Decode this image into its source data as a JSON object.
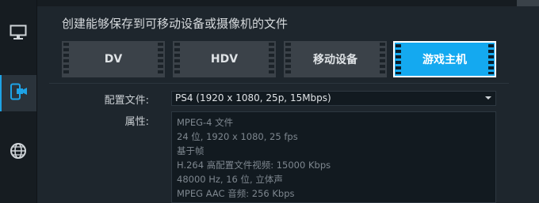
{
  "title": "创建能够保存到可移动设备或摄像机的文件",
  "sidebar": {
    "items": [
      {
        "icon": "monitor-icon"
      },
      {
        "icon": "mobile-camera-icon",
        "active": true
      },
      {
        "icon": "globe-icon"
      }
    ]
  },
  "tabs": [
    {
      "label": "DV",
      "active": false
    },
    {
      "label": "HDV",
      "active": false
    },
    {
      "label": "移动设备",
      "active": false
    },
    {
      "label": "游戏主机",
      "active": true
    }
  ],
  "form": {
    "profile_label": "配置文件:",
    "profile_value": "PS4 (1920 x 1080, 25p, 15Mbps)",
    "properties_label": "属性:",
    "properties": [
      "MPEG-4 文件",
      "24 位, 1920 x 1080, 25 fps",
      "基于帧",
      "H.264 高配置文件视频: 15000 Kbps",
      "48000 Hz, 16 位, 立体声",
      "MPEG AAC 音频: 256 Kbps"
    ]
  },
  "colors": {
    "accent": "#14a9f0",
    "tab_bg": "#3b4249",
    "background": "#1e262d"
  }
}
